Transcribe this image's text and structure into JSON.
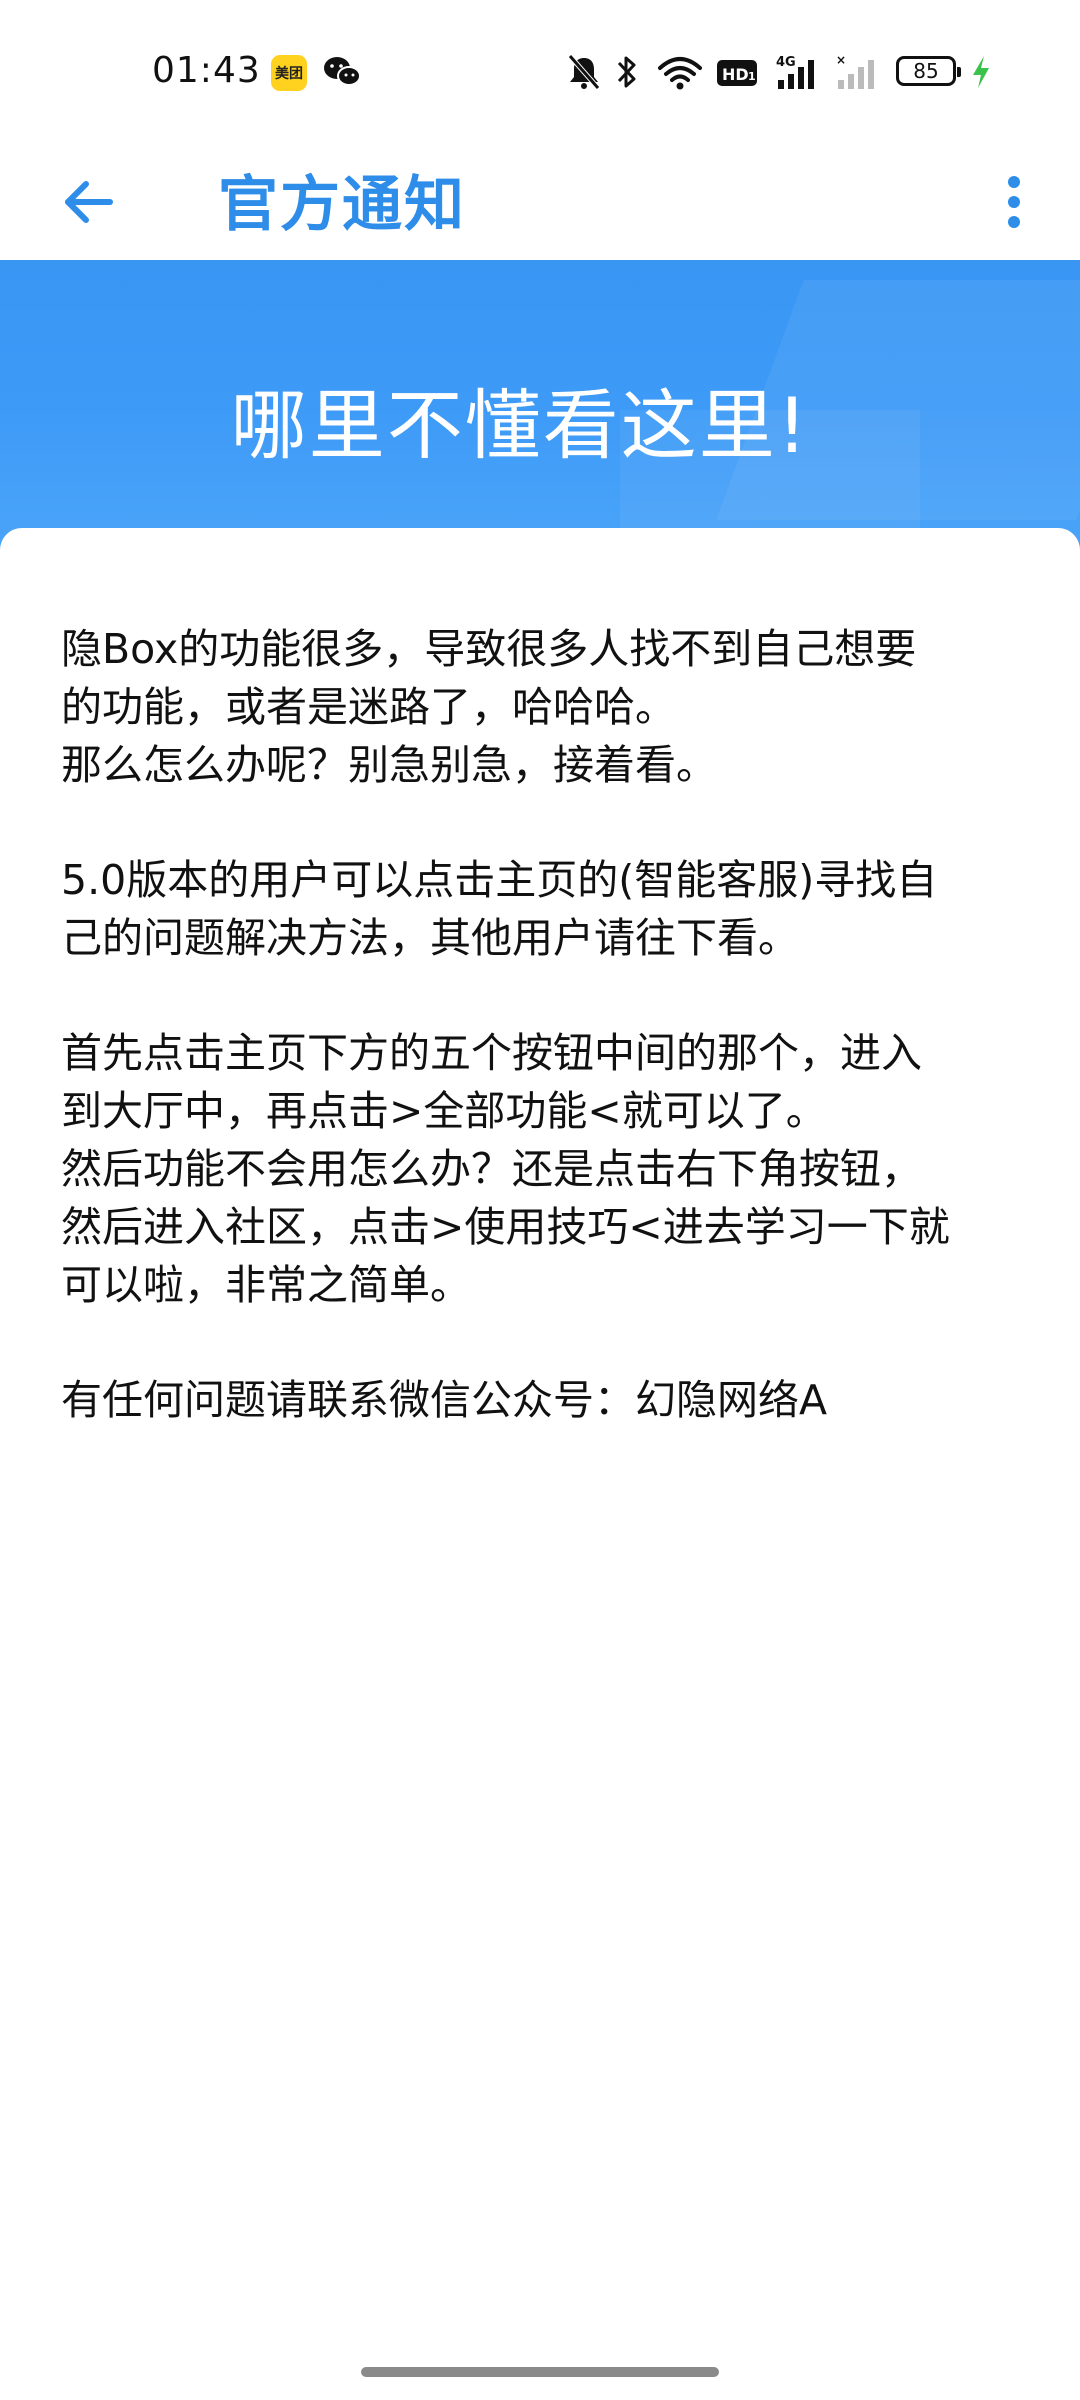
{
  "status_bar": {
    "time": "01:43",
    "meituan_label": "美团",
    "battery": "85",
    "icons": [
      "meituan-icon",
      "wechat-icon",
      "mute-bell-icon",
      "bluetooth-icon",
      "wifi-icon",
      "hd-icon",
      "signal-4g-icon",
      "signal-no-sim-icon",
      "battery-icon",
      "charging-bolt-icon"
    ]
  },
  "app_bar": {
    "title": "官方通知",
    "back_icon": "arrow-left-icon",
    "more_icon": "more-vert-icon"
  },
  "banner": {
    "headline": "哪里不懂看这里!"
  },
  "article": {
    "paragraphs": [
      [
        "隐Box的功能很多，导致很多人找不到自己想要",
        "的功能，或者是迷路了，哈哈哈。",
        "那么怎么办呢？别急别急，接着看。"
      ],
      [
        "5.0版本的用户可以点击主页的(智能客服)寻找自",
        "己的问题解决方法，其他用户请往下看。"
      ],
      [
        "首先点击主页下方的五个按钮中间的那个，进入",
        "到大厅中，再点击>全部功能<就可以了。",
        "然后功能不会用怎么办？还是点击右下角按钮，",
        "然后进入社区，点击>使用技巧<进去学习一下就",
        "可以啦，非常之简单。"
      ],
      [
        "有任何问题请联系微信公众号：幻隐网络A"
      ]
    ]
  },
  "colors": {
    "accent": "#2E8DE8",
    "banner": "#3D9AF7",
    "text": "#111111"
  }
}
